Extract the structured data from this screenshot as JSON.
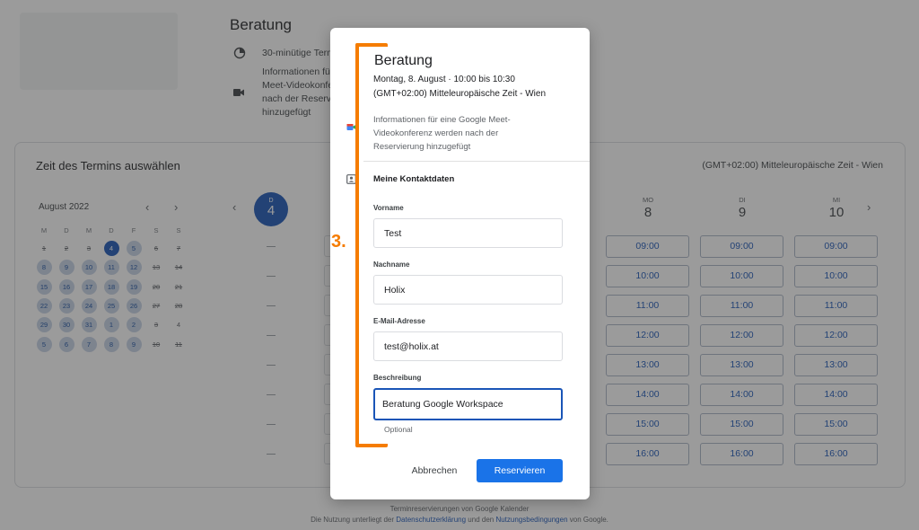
{
  "page": {
    "title": "Beratung",
    "duration": "30-minütige Termine",
    "meet_info_lines": [
      "Informationen für eine Google",
      "Meet-Videokonferenz werden",
      "nach der Reservierung",
      "hinzugefügt"
    ]
  },
  "booking": {
    "heading": "Zeit des Termins auswählen",
    "timezone": "(GMT+02:00) Mitteleuropäische Zeit - Wien",
    "mini_calendar": {
      "month": "August 2022",
      "weekdays": [
        "M",
        "D",
        "M",
        "D",
        "F",
        "S",
        "S"
      ],
      "weeks": [
        [
          {
            "d": "1",
            "s": "struck"
          },
          {
            "d": "2",
            "s": "struck"
          },
          {
            "d": "3",
            "s": "struck"
          },
          {
            "d": "4",
            "s": "sel"
          },
          {
            "d": "5",
            "s": "avail"
          },
          {
            "d": "6",
            "s": "struck"
          },
          {
            "d": "7",
            "s": "struck"
          }
        ],
        [
          {
            "d": "8",
            "s": "avail"
          },
          {
            "d": "9",
            "s": "avail"
          },
          {
            "d": "10",
            "s": "avail"
          },
          {
            "d": "11",
            "s": "avail"
          },
          {
            "d": "12",
            "s": "avail"
          },
          {
            "d": "13",
            "s": "struck"
          },
          {
            "d": "14",
            "s": "struck"
          }
        ],
        [
          {
            "d": "15",
            "s": "avail"
          },
          {
            "d": "16",
            "s": "avail"
          },
          {
            "d": "17",
            "s": "avail"
          },
          {
            "d": "18",
            "s": "avail"
          },
          {
            "d": "19",
            "s": "avail"
          },
          {
            "d": "20",
            "s": "struck"
          },
          {
            "d": "21",
            "s": "struck"
          }
        ],
        [
          {
            "d": "22",
            "s": "avail"
          },
          {
            "d": "23",
            "s": "avail"
          },
          {
            "d": "24",
            "s": "avail"
          },
          {
            "d": "25",
            "s": "avail"
          },
          {
            "d": "26",
            "s": "avail"
          },
          {
            "d": "27",
            "s": "struck"
          },
          {
            "d": "28",
            "s": "struck"
          }
        ],
        [
          {
            "d": "29",
            "s": "avail"
          },
          {
            "d": "30",
            "s": "avail"
          },
          {
            "d": "31",
            "s": "avail"
          },
          {
            "d": "1",
            "s": "avail"
          },
          {
            "d": "2",
            "s": "avail"
          },
          {
            "d": "3",
            "s": "struck"
          },
          {
            "d": "4",
            "s": "plain"
          }
        ],
        [
          {
            "d": "5",
            "s": "avail"
          },
          {
            "d": "6",
            "s": "avail"
          },
          {
            "d": "7",
            "s": "avail"
          },
          {
            "d": "8",
            "s": "avail"
          },
          {
            "d": "9",
            "s": "avail"
          },
          {
            "d": "10",
            "s": "struck"
          },
          {
            "d": "11",
            "s": "struck"
          }
        ]
      ]
    },
    "selected_day": {
      "name": "D",
      "num": "4"
    },
    "days": [
      {
        "name": "MO",
        "num": "8"
      },
      {
        "name": "DI",
        "num": "9"
      },
      {
        "name": "MI",
        "num": "10"
      }
    ],
    "times": [
      "09:00",
      "10:00",
      "11:00",
      "12:00",
      "13:00",
      "14:00",
      "15:00",
      "16:00"
    ]
  },
  "dialog": {
    "title": "Beratung",
    "datetime": "Montag, 8. August · 10:00 bis 10:30",
    "timezone": "(GMT+02:00) Mitteleuropäische Zeit - Wien",
    "meet_info": "Informationen für eine Google Meet-Videokonferenz werden nach der Reservierung hinzugefügt",
    "section": "Meine Kontaktdaten",
    "fields": {
      "first_name": {
        "label": "Vorname",
        "value": "Test"
      },
      "last_name": {
        "label": "Nachname",
        "value": "Holix"
      },
      "email": {
        "label": "E-Mail-Adresse",
        "value": "test@holix.at"
      },
      "description": {
        "label": "Beschreibung",
        "value": "Beratung Google Workspace",
        "hint": "Optional"
      }
    },
    "cancel_label": "Abbrechen",
    "submit_label": "Reservieren"
  },
  "annotation": {
    "step": "3."
  },
  "footer": {
    "line1": "Terminreservierungen von Google Kalender",
    "line2_pre": "Die Nutzung unterliegt der ",
    "privacy_link": "Datenschutzerklärung",
    "line2_mid": " und den ",
    "terms_link": "Nutzungsbedingungen",
    "line2_post": " von Google."
  },
  "colors": {
    "accent": "#1a73e8",
    "annotation": "#f57c00",
    "selected": "#1a55b7"
  }
}
